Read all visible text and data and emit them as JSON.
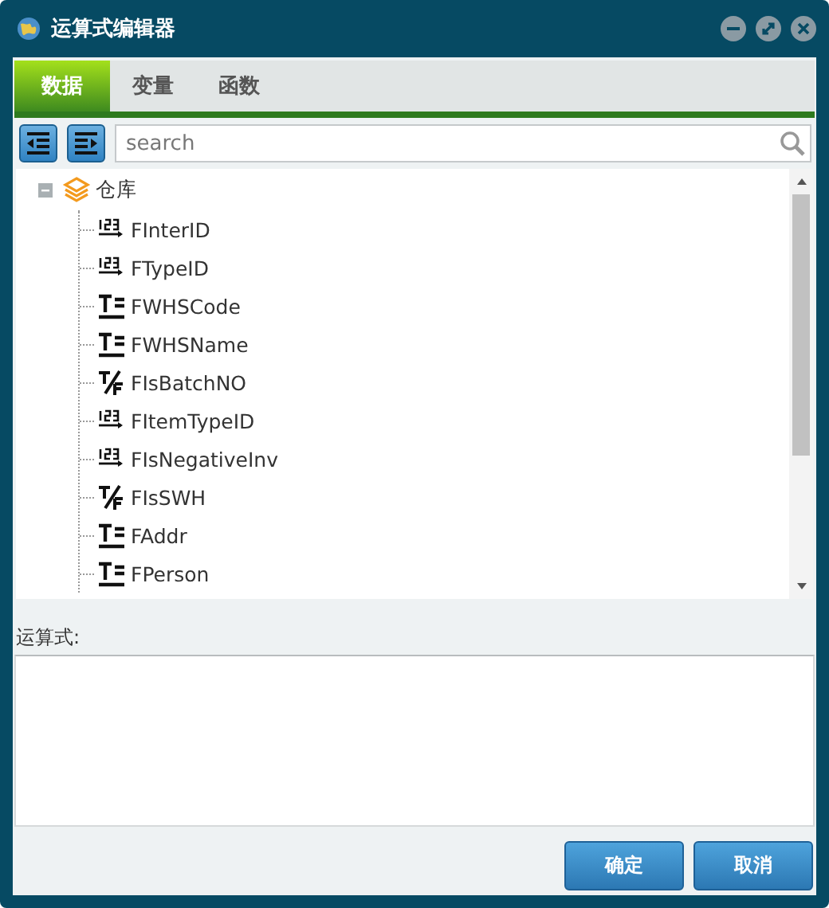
{
  "window": {
    "title": "运算式编辑器"
  },
  "tabs": [
    {
      "label": "数据",
      "selected": true
    },
    {
      "label": "变量",
      "selected": false
    },
    {
      "label": "函数",
      "selected": false
    }
  ],
  "search": {
    "placeholder": "search"
  },
  "tree": [
    {
      "label": "仓库",
      "expanded": true,
      "children": [
        {
          "label": "FInterID",
          "kind": "number"
        },
        {
          "label": "FTypeID",
          "kind": "number"
        },
        {
          "label": "FWHSCode",
          "kind": "text"
        },
        {
          "label": "FWHSName",
          "kind": "text"
        },
        {
          "label": "FIsBatchNO",
          "kind": "bool"
        },
        {
          "label": "FItemTypeID",
          "kind": "number"
        },
        {
          "label": "FIsNegativeInv",
          "kind": "number"
        },
        {
          "label": "FIsSWH",
          "kind": "bool"
        },
        {
          "label": "FAddr",
          "kind": "text"
        },
        {
          "label": "FPerson",
          "kind": "text"
        }
      ]
    }
  ],
  "formula": {
    "label": "运算式:"
  },
  "buttons": [
    "确定",
    "取消"
  ]
}
